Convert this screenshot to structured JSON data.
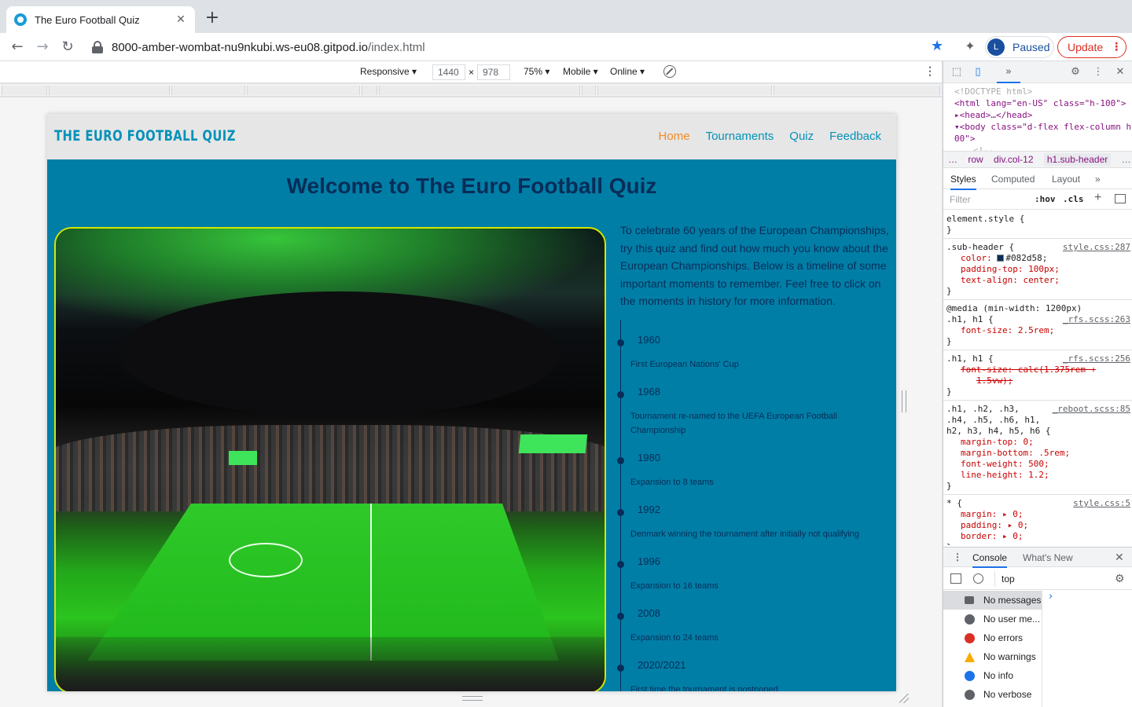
{
  "browser": {
    "tab_title": "The Euro Football Quiz",
    "tab_close": "✕",
    "new_tab": "+",
    "url_host": "8000-amber-wombat-nu9nkubi.ws-eu08.gitpod.io",
    "url_path": "/index.html",
    "profile_initial": "L",
    "profile_label": "Paused",
    "update_label": "Update"
  },
  "device_toolbar": {
    "device": "Responsive ▾",
    "width": "1440",
    "times": "×",
    "height": "978",
    "zoom": "75% ▾",
    "mode": "Mobile ▾",
    "network": "Online ▾"
  },
  "site": {
    "brand": "THE EURO FOOTBALL QUIZ",
    "nav": [
      "Home",
      "Tournaments",
      "Quiz",
      "Feedback"
    ],
    "heading": "Welcome to The Euro Football Quiz",
    "intro": "To celebrate 60 years of the European Championships, try this quiz and find out how much you know about the European Championships. Below is a timeline of some important moments to remember. Feel free to click on the moments in history for more information.",
    "timeline": [
      {
        "year": "1960",
        "desc": "First European Nations' Cup"
      },
      {
        "year": "1968",
        "desc": "Tournament re-named to the UEFA European Football Championship"
      },
      {
        "year": "1980",
        "desc": "Expansion to 8 teams"
      },
      {
        "year": "1992",
        "desc": "Denmark winning the tournament after initially not qualifying"
      },
      {
        "year": "1996",
        "desc": "Expansion to 16 teams"
      },
      {
        "year": "2008",
        "desc": "Expansion to 24 teams"
      },
      {
        "year": "2020/2021",
        "desc": "First time the tournament is postponed"
      }
    ]
  },
  "devtools": {
    "dom": {
      "doctype": "<!DOCTYPE html>",
      "html_line": "<html lang=\"en-US\" class=\"h-100\">",
      "head_line": "▸<head>…</head>",
      "body_line": "▾<body class=\"d-flex flex-column h-1",
      "body_line2": "00\">",
      "comment": "<!--"
    },
    "breadcrumbs": [
      "…",
      "row",
      "div.col-12",
      "h1.sub-header",
      "…"
    ],
    "panel_tabs": [
      "Styles",
      "Computed",
      "Layout",
      "»"
    ],
    "filter_placeholder": "Filter",
    "hov": ":hov",
    "cls": ".cls",
    "rules": {
      "element_style": "element.style {",
      "close": "}",
      "sub_header_sel": ".sub-header {",
      "sub_header_src": "style.css:287",
      "color_prop": "color:",
      "color_val": "#082d58;",
      "padding_top": "padding-top: 100px;",
      "text_align": "text-align: center;",
      "media": "@media (min-width: 1200px)",
      "h1_sel": ".h1, h1 {",
      "h1_src": "_rfs.scss:263",
      "font_size": "font-size: 2.5rem;",
      "h1_sel2": ".h1, h1 {",
      "h1_src2": "_rfs.scss:256",
      "font_size_strike": "font-size: calc(1.375rem +",
      "font_size_strike2": "1.5vw);",
      "reboot_sel": ".h1, .h2, .h3,",
      "reboot_sel2": ".h4, .h5, .h6, h1,",
      "reboot_sel3": "h2, h3, h4, h5, h6 {",
      "reboot_src": "_reboot.scss:85",
      "margin_top": "margin-top: 0;",
      "margin_bottom": "margin-bottom: .5rem;",
      "font_weight": "font-weight: 500;",
      "line_height": "line-height: 1.2;",
      "star_sel": "* {",
      "star_src": "style.css:5",
      "margin": "margin: ▸ 0;",
      "padding": "padding: ▸ 0;",
      "border": "border: ▸ 0;"
    },
    "drawer_tabs": [
      "Console",
      "What's New"
    ],
    "context": "top",
    "messages": [
      {
        "label": "No messages",
        "icon": "list-icon",
        "color": "#5f6368"
      },
      {
        "label": "No user me...",
        "icon": "user-icon",
        "color": "#5f6368"
      },
      {
        "label": "No errors",
        "icon": "error-icon",
        "color": "#d93025"
      },
      {
        "label": "No warnings",
        "icon": "warning-icon",
        "color": "#f9ab00"
      },
      {
        "label": "No info",
        "icon": "info-icon",
        "color": "#1a73e8"
      },
      {
        "label": "No verbose",
        "icon": "bug-icon",
        "color": "#5f6368"
      }
    ],
    "prompt": "›"
  },
  "colors": {
    "page_bg": "#017ea6",
    "heading": "#082d58",
    "brand": "#0591b8",
    "nav_active": "#f28c28",
    "image_border": "#d5e600"
  }
}
